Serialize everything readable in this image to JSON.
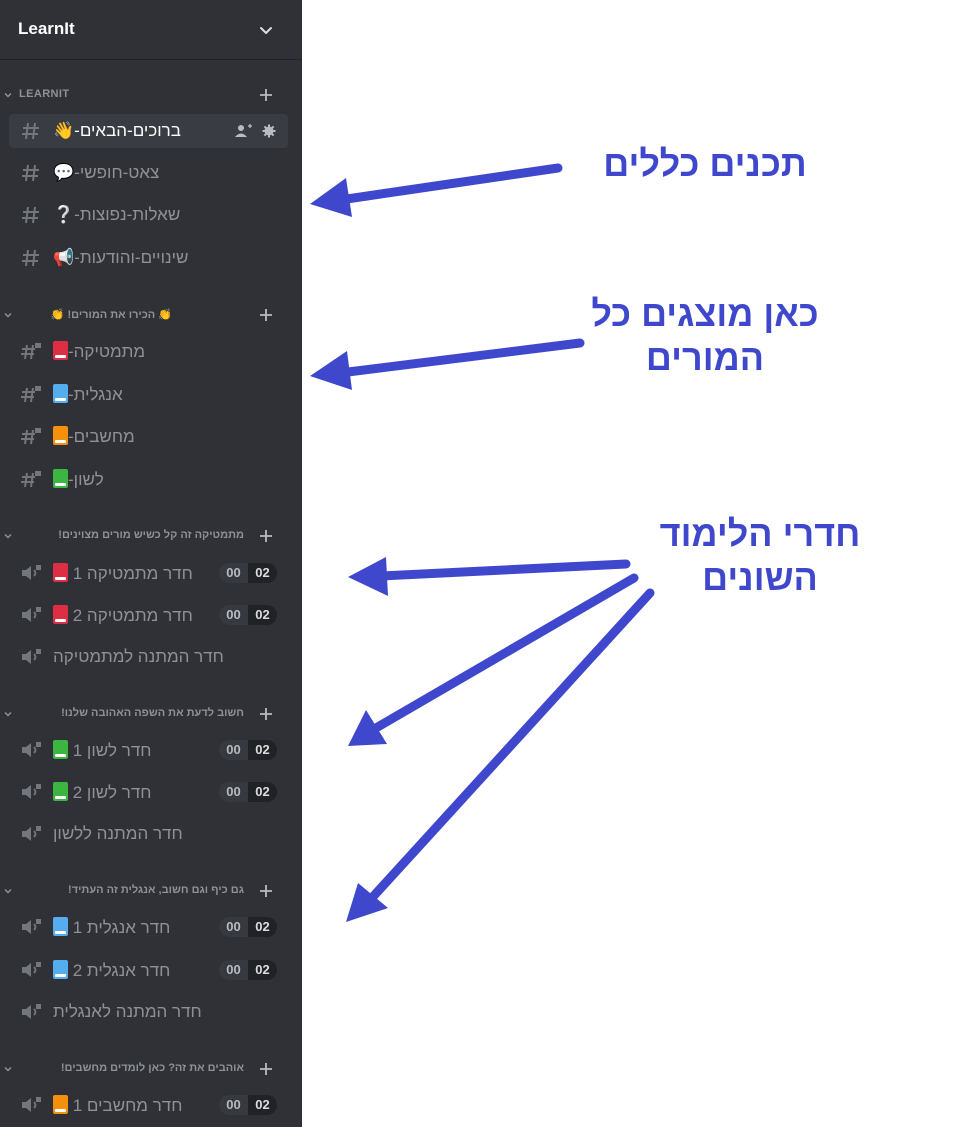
{
  "server": {
    "name": "LearnIt"
  },
  "categories": [
    {
      "name": "LEARNIT",
      "channels": [
        {
          "label": "ברוכים-הבאים-👋"
        },
        {
          "label": "צאט-חופשי-💬"
        },
        {
          "label": "שאלות-נפוצות-❔"
        },
        {
          "label": "שינויים-והודעות-📢"
        }
      ]
    },
    {
      "name": "👏 הכירו את המורים! 👏",
      "channels": [
        {
          "label": "מתמטיקה-"
        },
        {
          "label": "אנגלית-"
        },
        {
          "label": "מחשבים-"
        },
        {
          "label": "לשון-"
        }
      ]
    },
    {
      "name": "מתמטיקה זה קל כשיש מורים מצוינים!",
      "channels": [
        {
          "label": "חדר מתמטיקה 1",
          "users": "00",
          "limit": "02"
        },
        {
          "label": "חדר מתמטיקה 2",
          "users": "00",
          "limit": "02"
        },
        {
          "label": "חדר המתנה למתמטיקה"
        }
      ]
    },
    {
      "name": "חשוב לדעת את השפה האהובה שלנו!",
      "channels": [
        {
          "label": "חדר לשון 1",
          "users": "00",
          "limit": "02"
        },
        {
          "label": "חדר לשון 2",
          "users": "00",
          "limit": "02"
        },
        {
          "label": "חדר המתנה ללשון"
        }
      ]
    },
    {
      "name": "גם כיף וגם חשוב, אנגלית זה העתיד!",
      "channels": [
        {
          "label": "חדר אנגלית 1",
          "users": "00",
          "limit": "02"
        },
        {
          "label": "חדר אנגלית 2",
          "users": "00",
          "limit": "02"
        },
        {
          "label": "חדר המתנה לאנגלית"
        }
      ]
    },
    {
      "name": "אוהבים את זה? כאן לומדים מחשבים!",
      "channels": [
        {
          "label": "חדר מחשבים 1",
          "users": "00",
          "limit": "02"
        }
      ]
    }
  ],
  "annotations": {
    "general": "תכנים כללים",
    "teachers_line1": "כאן מוצגים כל",
    "teachers_line2": "המורים",
    "rooms_line1": "חדרי הלימוד",
    "rooms_line2": "השונים"
  },
  "colors": {
    "sidebar_bg": "#2f3136",
    "selected_bg": "#393c43",
    "annotation": "#3f48cc"
  }
}
